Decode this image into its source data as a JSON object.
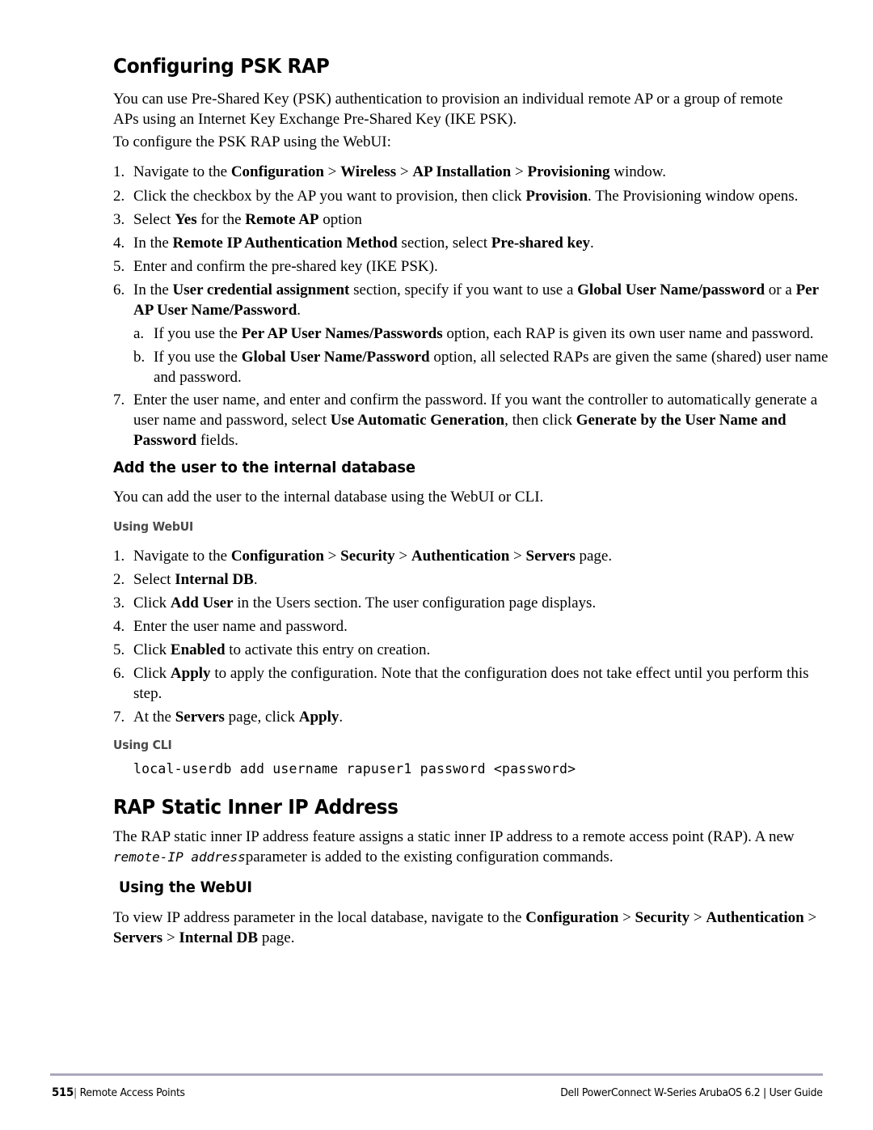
{
  "page": {
    "number": "515",
    "section": "Remote Access Points",
    "guide": "Dell PowerConnect W-Series ArubaOS 6.2 | User Guide",
    "separator": "|"
  },
  "colors": {
    "footer_rule": "#aaa8bc",
    "subheading": "#4a4a4a",
    "text": "#000000",
    "background": "#ffffff"
  },
  "sections": {
    "configuring_psk_rap": {
      "heading": "Configuring PSK RAP",
      "intro_paragraph": "You can use Pre-Shared Key (PSK) authentication to provision an individual remote AP or a group of remote APs using an Internet Key Exchange Pre-Shared Key (IKE PSK).",
      "lead_in": "To configure the PSK RAP using the WebUI:",
      "steps": {
        "s1_a": "Navigate to the ",
        "s1_b1": "Configuration",
        "s1_b2": " > ",
        "s1_b3": "Wireless",
        "s1_b4": " > ",
        "s1_b5": "AP Installation",
        "s1_b6": " > ",
        "s1_b7": "Provisioning",
        "s1_c": " window.",
        "s2_a": "Click the checkbox by the AP you want to provision, then click ",
        "s2_b": "Provision",
        "s2_c": ". The Provisioning window opens.",
        "s3_a": "Select ",
        "s3_b": "Yes",
        "s3_c": " for the ",
        "s3_d": "Remote AP",
        "s3_e": " option",
        "s4_a": "In the ",
        "s4_b": "Remote IP Authentication Method",
        "s4_c": " section, select ",
        "s4_d": "Pre-shared key",
        "s4_e": ".",
        "s5": "Enter and confirm the pre-shared key (IKE PSK).",
        "s6_a": "In the ",
        "s6_b": "User credential assignment",
        "s6_c": " section, specify if you want to use a ",
        "s6_d": "Global User Name/password",
        "s6_e": " or a ",
        "s6_f": "Per AP User Name/Password",
        "s6_g": ".",
        "s6a_a": "If you use the ",
        "s6a_b": "Per AP User Names/Passwords",
        "s6a_c": " option, each RAP is given its own user name and password.",
        "s6b_a": "If you use the ",
        "s6b_b": "Global User Name/Password",
        "s6b_c": " option, all selected RAPs are given the same (shared) user name and password.",
        "s7_a": "Enter the user name, and enter and confirm the password. If you want the controller to automatically generate a user name and password, select ",
        "s7_b": "Use Automatic Generation",
        "s7_c": ", then click ",
        "s7_d": "Generate by the User Name and Password",
        "s7_e": " fields."
      },
      "markers": {
        "n1": "1.",
        "n2": "2.",
        "n3": "3.",
        "n4": "4.",
        "n5": "5.",
        "n6": "6.",
        "n7": "7.",
        "a": "a.",
        "b": "b."
      }
    },
    "add_user_internal_db": {
      "heading": "Add the user to the internal database",
      "paragraph": "You can add the user to the internal database using the WebUI or CLI.",
      "using_webui_heading": "Using WebUI",
      "webui_steps": {
        "w1_a": "Navigate to the ",
        "w1_b1": "Configuration",
        "w1_b2": " > ",
        "w1_b3": "Security",
        "w1_b4": " > ",
        "w1_b5": "Authentication",
        "w1_b6": " > ",
        "w1_b7": "Servers",
        "w1_c": " page.",
        "w2_a": "Select ",
        "w2_b": "Internal DB",
        "w2_c": ".",
        "w3_a": "Click ",
        "w3_b": "Add User",
        "w3_c": " in the Users section. The user configuration page displays.",
        "w4": "Enter the user name and password.",
        "w5_a": "Click ",
        "w5_b": "Enabled",
        "w5_c": " to activate this entry on creation.",
        "w6_a": "Click ",
        "w6_b": "Apply",
        "w6_c": " to apply the configuration. Note that the configuration does not take effect until you perform this step.",
        "w7_a": "At the ",
        "w7_b": "Servers",
        "w7_c": " page, click ",
        "w7_d": "Apply",
        "w7_e": "."
      },
      "using_cli_heading": "Using CLI",
      "cli_command": "local-userdb add username rapuser1 password <password>"
    },
    "rap_static_inner_ip": {
      "heading": "RAP Static Inner IP Address",
      "paragraph_a": "The RAP static inner IP address feature assigns a static inner IP address to a remote access point (RAP). A new ",
      "paragraph_mono": "remote-IP address",
      "paragraph_b": "parameter is added to the existing configuration commands.",
      "using_webui_heading": "Using the WebUI",
      "closing_a": "To view IP address parameter in the local database, navigate to the ",
      "closing_b1": "Configuration",
      "closing_b2": " > ",
      "closing_b3": "Security",
      "closing_b4": " > ",
      "closing_b5": "Authentication",
      "closing_b6": " > ",
      "closing_b7": "Servers",
      "closing_b8": " > ",
      "closing_b9": "Internal DB",
      "closing_c": " page."
    }
  }
}
